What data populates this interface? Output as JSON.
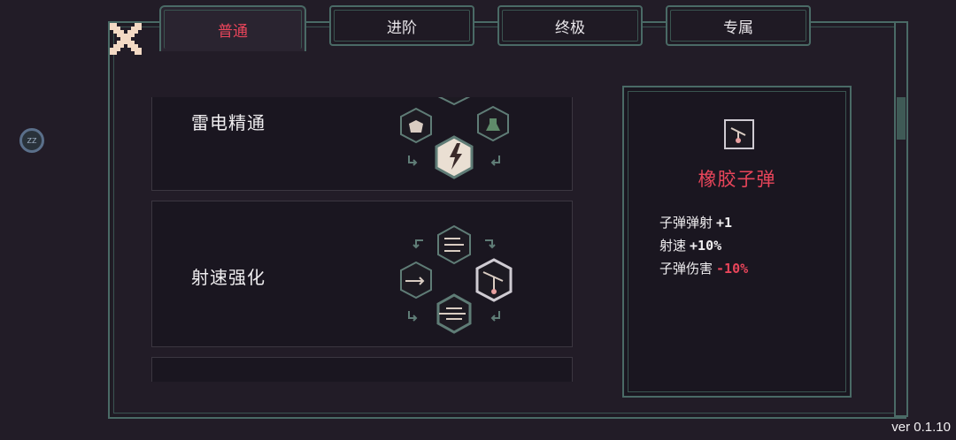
{
  "tabs": [
    {
      "label": "普通",
      "active": true
    },
    {
      "label": "进阶",
      "active": false
    },
    {
      "label": "终极",
      "active": false
    },
    {
      "label": "专属",
      "active": false
    }
  ],
  "side_knob_label": "ZZ",
  "cards": [
    {
      "title": "雷电精通",
      "icons": [
        "lightning-hex-icon",
        "monster-hex-icon",
        "potion-hex-icon"
      ]
    },
    {
      "title": "射速强化",
      "icons": [
        "multi-shot-hex-icon",
        "dash-shot-hex-icon",
        "rubber-bullet-hex-icon",
        "triple-shot-hex-icon"
      ]
    }
  ],
  "detail": {
    "icon": "rubber-bullet-icon",
    "name": "橡胶子弹",
    "stats": [
      {
        "label": "子弹弹射",
        "value": "+1",
        "negative": false
      },
      {
        "label": "射速",
        "value": "+10%",
        "negative": false
      },
      {
        "label": "子弹伤害",
        "value": "-10%",
        "negative": true
      }
    ]
  },
  "version": "ver 0.1.10",
  "colors": {
    "accent_red": "#e8455a",
    "frame": "#4a6a66",
    "background": "#221c27"
  }
}
